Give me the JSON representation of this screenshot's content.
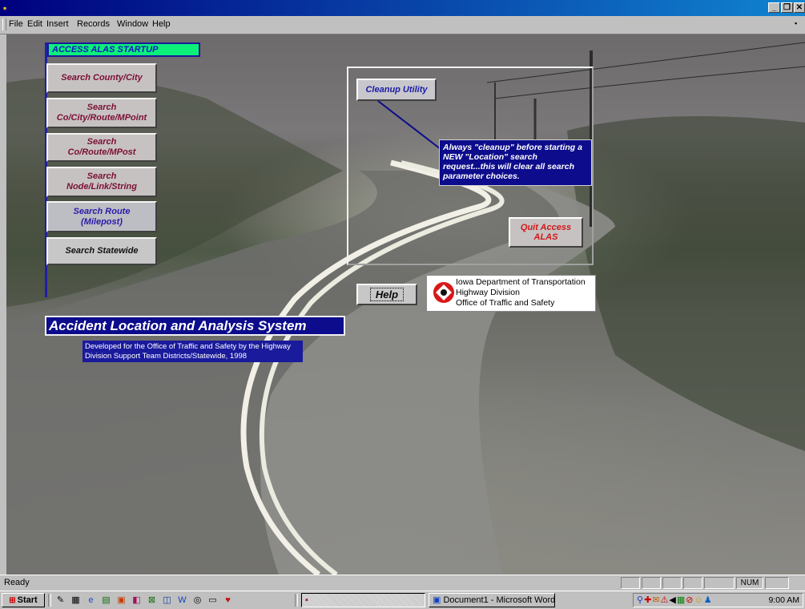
{
  "window": {
    "min_glyph": "_",
    "restore_glyph": "❐",
    "close_glyph": "✕"
  },
  "menubar": {
    "items": [
      "File",
      "Edit",
      "Insert",
      "Records",
      "Window",
      "Help"
    ]
  },
  "form": {
    "startup_label": "ACCESS ALAS STARTUP",
    "nav_buttons": [
      "Search County/City",
      "Search\nCo/City/Route/MPoint",
      "Search\nCo/Route/MPost",
      "Search\nNode/Link/String",
      "Search  Route\n(Milepost)",
      "Search  Statewide"
    ],
    "cleanup_button": "Cleanup Utility",
    "cleanup_tip": "Always \"cleanup\" before starting a NEW \"Location\" search request...this will clear all search parameter choices.",
    "quit_button": "Quit Access\nALAS",
    "help_button": "Help",
    "dot_lines": [
      "Iowa Department of Transportation",
      "Highway Division",
      "Office of Traffic and Safety"
    ],
    "system_title": "Accident Location and Analysis System",
    "developed_text": "Developed for the Office of Traffic and Safety by the Highway Division Support Team Districts/Statewide, 1998"
  },
  "statusbar": {
    "text": "Ready",
    "num_indicator": "NUM"
  },
  "taskbar": {
    "start_label": "Start",
    "tasks": [
      "",
      "Document1 - Microsoft Word"
    ],
    "clock": "9:00 AM"
  },
  "colors": {
    "title_bar": "#00007e",
    "startup_label_bg": "#0cf07a",
    "tip_bg": "#0c0c8c",
    "quit_text": "#d01818",
    "nav_text": "#7a0f35"
  }
}
